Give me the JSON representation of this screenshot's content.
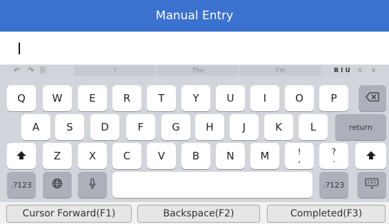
{
  "header": {
    "title": "Manual Entry"
  },
  "entry": {
    "value": ""
  },
  "toolbar": {
    "undo_icon": "undo-icon",
    "redo_icon": "redo-icon",
    "paste_icon": "clipboard-icon",
    "suggestions": [
      "I",
      "The",
      "I'm"
    ],
    "format_label": "B I U",
    "up_icon": "chevron-up-icon",
    "down_icon": "chevron-down-icon"
  },
  "keyboard": {
    "row1": [
      "Q",
      "W",
      "E",
      "R",
      "T",
      "Y",
      "U",
      "I",
      "O",
      "P"
    ],
    "row2": [
      "A",
      "S",
      "D",
      "F",
      "G",
      "H",
      "J",
      "K",
      "L"
    ],
    "row3": [
      "Z",
      "X",
      "C",
      "V",
      "B",
      "N",
      "M"
    ],
    "return_label": "return",
    "num_label": ".?123",
    "punct1_top": "!",
    "punct1_bottom": ",",
    "punct2_top": "?",
    "punct2_bottom": ".",
    "globe_icon": "globe-icon",
    "mic_icon": "microphone-icon",
    "hide_icon": "keyboard-hide-icon",
    "backspace_icon": "backspace-icon",
    "shift_icon": "shift-icon"
  },
  "footer": {
    "btn1": "Cursor Forward(F1)",
    "btn2": "Backspace(F2)",
    "btn3": "Completed(F3)"
  },
  "colors": {
    "header": "#3b72cf",
    "keyboard_bg": "#d2d5db",
    "key": "#ffffff",
    "key_dark": "#abb0ba"
  }
}
